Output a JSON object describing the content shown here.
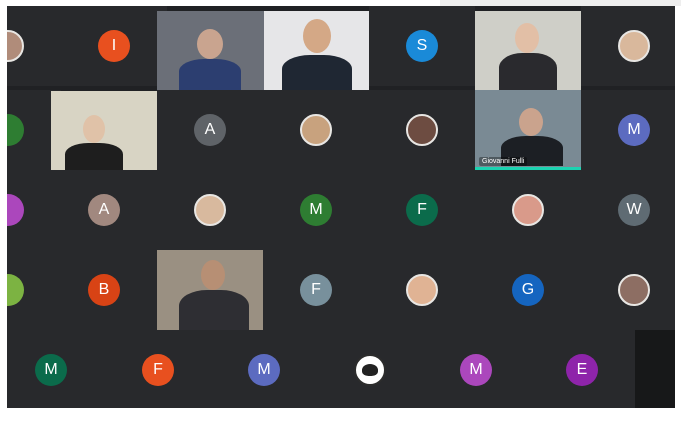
{
  "meeting": {
    "title": "",
    "participants": [
      {
        "initial": "I",
        "color": "#e8501f"
      },
      {
        "initial": "S",
        "color": "#1a8ad8"
      },
      {
        "initial": "A",
        "color": "#5f6368"
      },
      {
        "initial": "M",
        "color": "#5c6bc0"
      },
      {
        "initial": "A",
        "color": "#a1887f"
      },
      {
        "initial": "M",
        "color": "#2e7d32"
      },
      {
        "initial": "F",
        "color": "#0b6b4b"
      },
      {
        "initial": "W",
        "color": "#5f6b73"
      },
      {
        "initial": "B",
        "color": "#d84315"
      },
      {
        "initial": "F",
        "color": "#78909c"
      },
      {
        "initial": "G",
        "color": "#1565c0"
      },
      {
        "initial": "M",
        "color": "#0b6b4b"
      },
      {
        "initial": "F",
        "color": "#e8501f"
      },
      {
        "initial": "M",
        "color": "#5c6bc0"
      },
      {
        "initial": "M",
        "color": "#ab47bc"
      },
      {
        "initial": "E",
        "color": "#8e24aa"
      }
    ],
    "speaker_name": "Giovanni Fulli"
  }
}
